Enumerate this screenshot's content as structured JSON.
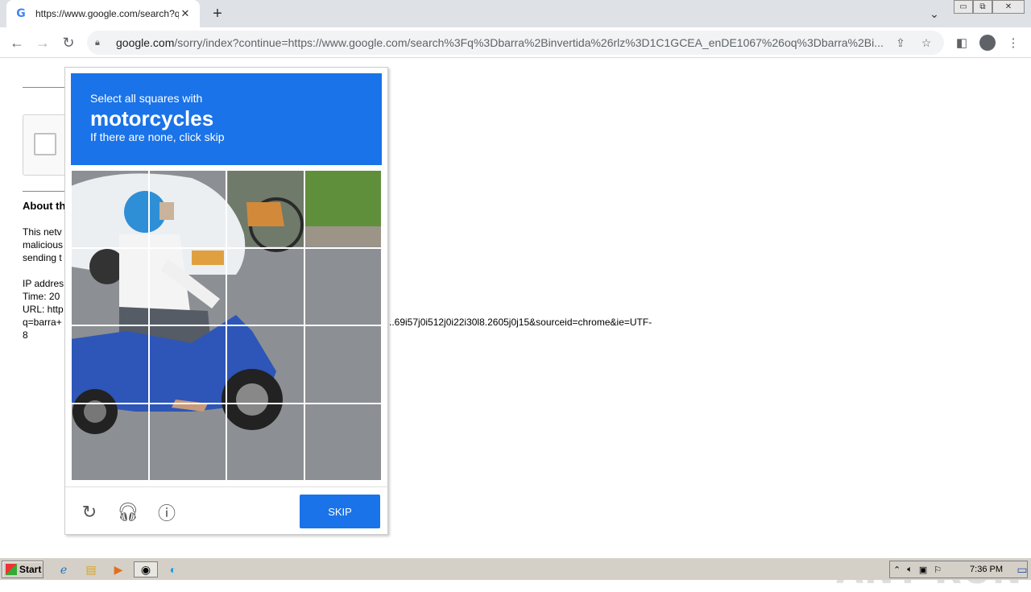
{
  "browser": {
    "tab_title": "https://www.google.com/search?q=",
    "favicon_letter": "G",
    "url_host": "google.com",
    "url_path": "/sorry/index?continue=https://www.google.com/search%3Fq%3Dbarra%2Binvertida%26rlz%3D1C1GCEA_enDE1067%26oq%3Dbarra%2Bi..."
  },
  "page": {
    "about_heading": "About th",
    "para_line1": "This netv",
    "para_line2": "malicious",
    "para_line3": "sending t",
    "ip_line": "IP addres",
    "time_line": "Time: 20",
    "url_line": "URL: http",
    "url_cont_line": "q=barra+",
    "url_tail": "..69i57j0i512j0i22i30l8.2605j0j15&sourceid=chrome&ie=UTF-",
    "url_tail2": "8"
  },
  "captcha": {
    "instruction": "Select all squares with",
    "target": "motorcycles",
    "hint": "If there are none, click skip",
    "skip_label": "SKIP"
  },
  "watermark": "ANY  RUN",
  "taskbar": {
    "start_label": "Start",
    "clock": "7:36 PM"
  },
  "colors": {
    "accent": "#1a73e8"
  }
}
